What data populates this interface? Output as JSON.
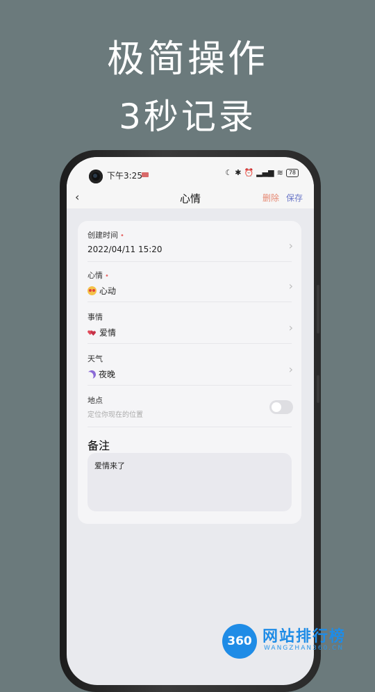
{
  "promo": {
    "line1": "极简操作",
    "line2": "3秒记录"
  },
  "status": {
    "time": "下午3:25",
    "battery": "78"
  },
  "nav": {
    "back_icon": "chevron-left-icon",
    "title": "心情",
    "delete_label": "删除",
    "save_label": "保存"
  },
  "form": {
    "created": {
      "label": "创建时间",
      "value": "2022/04/11 15:20"
    },
    "mood": {
      "label": "心情",
      "icon": "heart-eyes-emoji-icon",
      "value": "心动"
    },
    "event": {
      "label": "事情",
      "icon": "hearts-icon",
      "value": "爱情"
    },
    "weather": {
      "label": "天气",
      "icon": "moon-icon",
      "value": "夜晚"
    },
    "location": {
      "label": "地点",
      "hint": "定位你现在的位置"
    },
    "note": {
      "label": "备注",
      "value": "爱情来了"
    }
  },
  "watermark": {
    "badge": "360",
    "name": "网站排行榜",
    "sub": "WANGZHAN360.CN"
  },
  "colors": {
    "background": "#6b7a7c",
    "delete": "#e58872",
    "save": "#6c78c8",
    "watermark": "#1f8ce6"
  }
}
